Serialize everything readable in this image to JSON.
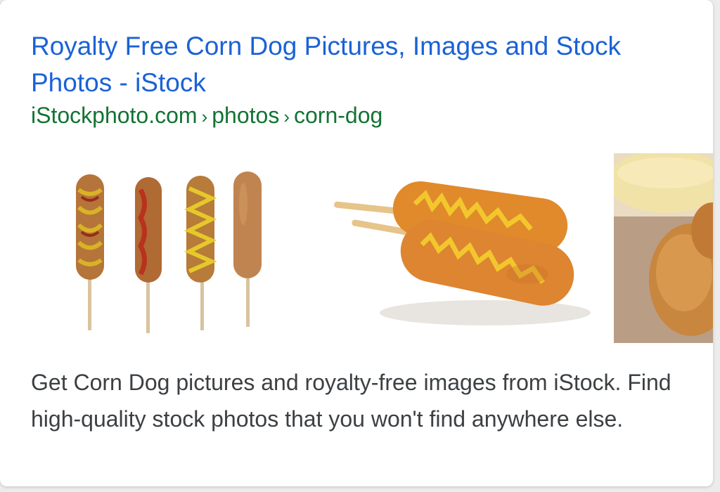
{
  "result": {
    "title": "Royalty Free Corn Dog Pictures, Images and Stock Photos - iStock",
    "breadcrumb": [
      "iStockphoto.com",
      "photos",
      "corn-dog"
    ],
    "breadcrumb_separator": "›",
    "snippet": "Get Corn Dog pictures and royalty-free images from iStock. Find high-quality stock photos that you won't find anywhere else."
  },
  "colors": {
    "title_link": "#1a62d6",
    "breadcrumb": "#137333",
    "snippet_text": "#3c4043"
  },
  "images": [
    {
      "subject": "four corn dogs on sticks with mustard and ketchup"
    },
    {
      "subject": "two corn dogs with mustard zigzag"
    },
    {
      "subject": "corn dogs with dipping sauce (cropped)"
    }
  ]
}
